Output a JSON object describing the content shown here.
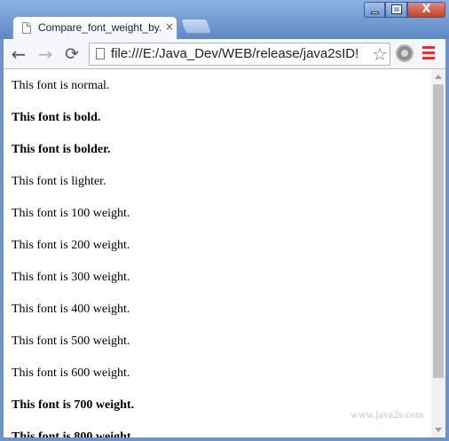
{
  "window": {
    "tab_title": "Compare_font_weight_by...",
    "close_tab": "×",
    "minimize": "",
    "maximize": "",
    "close_window": "X"
  },
  "toolbar": {
    "back": "←",
    "forward": "→",
    "reload": "⟳",
    "url": "file:///E:/Java_Dev/WEB/release/java2sID!",
    "bookmark": "☆"
  },
  "content": {
    "lines": [
      "This font is normal.",
      "This font is bold.",
      "This font is bolder.",
      "This font is lighter.",
      "This font is 100 weight.",
      "This font is 200 weight.",
      "This font is 300 weight.",
      "This font is 400 weight.",
      "This font is 500 weight.",
      "This font is 600 weight.",
      "This font is 700 weight.",
      "This font is 800 weight."
    ],
    "bold_flags": [
      false,
      true,
      true,
      false,
      false,
      false,
      false,
      false,
      false,
      false,
      true,
      true
    ],
    "watermark": "www.java2s.com"
  },
  "colors": {
    "frame": "#6d93c7",
    "menu_icon": "#dd3333",
    "scroll_thumb": "#c1c1c1"
  }
}
